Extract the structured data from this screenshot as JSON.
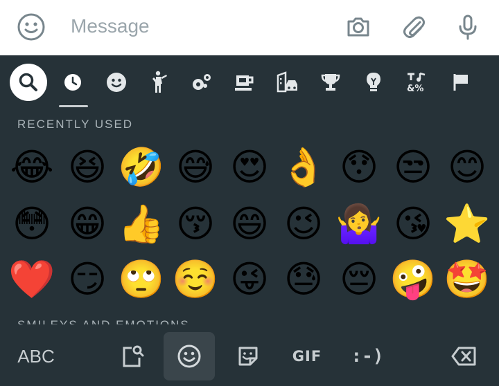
{
  "message_bar": {
    "placeholder": "Message"
  },
  "categories": [
    {
      "name": "search"
    },
    {
      "name": "recent",
      "selected": true
    },
    {
      "name": "smileys"
    },
    {
      "name": "people"
    },
    {
      "name": "animals-nature"
    },
    {
      "name": "food-drink"
    },
    {
      "name": "travel-places"
    },
    {
      "name": "activities"
    },
    {
      "name": "objects"
    },
    {
      "name": "symbols"
    },
    {
      "name": "flags"
    }
  ],
  "section": {
    "title": "RECENTLY USED",
    "next_title": "SMILEYS AND EMOTIONS"
  },
  "emojis": [
    "😂",
    "😆",
    "🤣",
    "😅",
    "😍",
    "👌",
    "😯",
    "😒",
    "😊",
    "😳",
    "😁",
    "👍",
    "😚",
    "😄",
    "😉",
    "🤷‍♀️",
    "😘",
    "⭐",
    "❤️",
    "😏",
    "🙄",
    "☺️",
    "😜",
    "😓",
    "😔",
    "🤪",
    "🤩"
  ],
  "bottom_bar": {
    "abc_label": "ABC",
    "gif_label": "GIF",
    "emoticon_label": ":-)"
  },
  "colors": {
    "keyboard_bg": "#263238",
    "icon": "#c7cdd0",
    "selected_tab_bg": "#3a454b",
    "message_bar_bg": "#ffffff",
    "message_icon": "#78868d"
  }
}
